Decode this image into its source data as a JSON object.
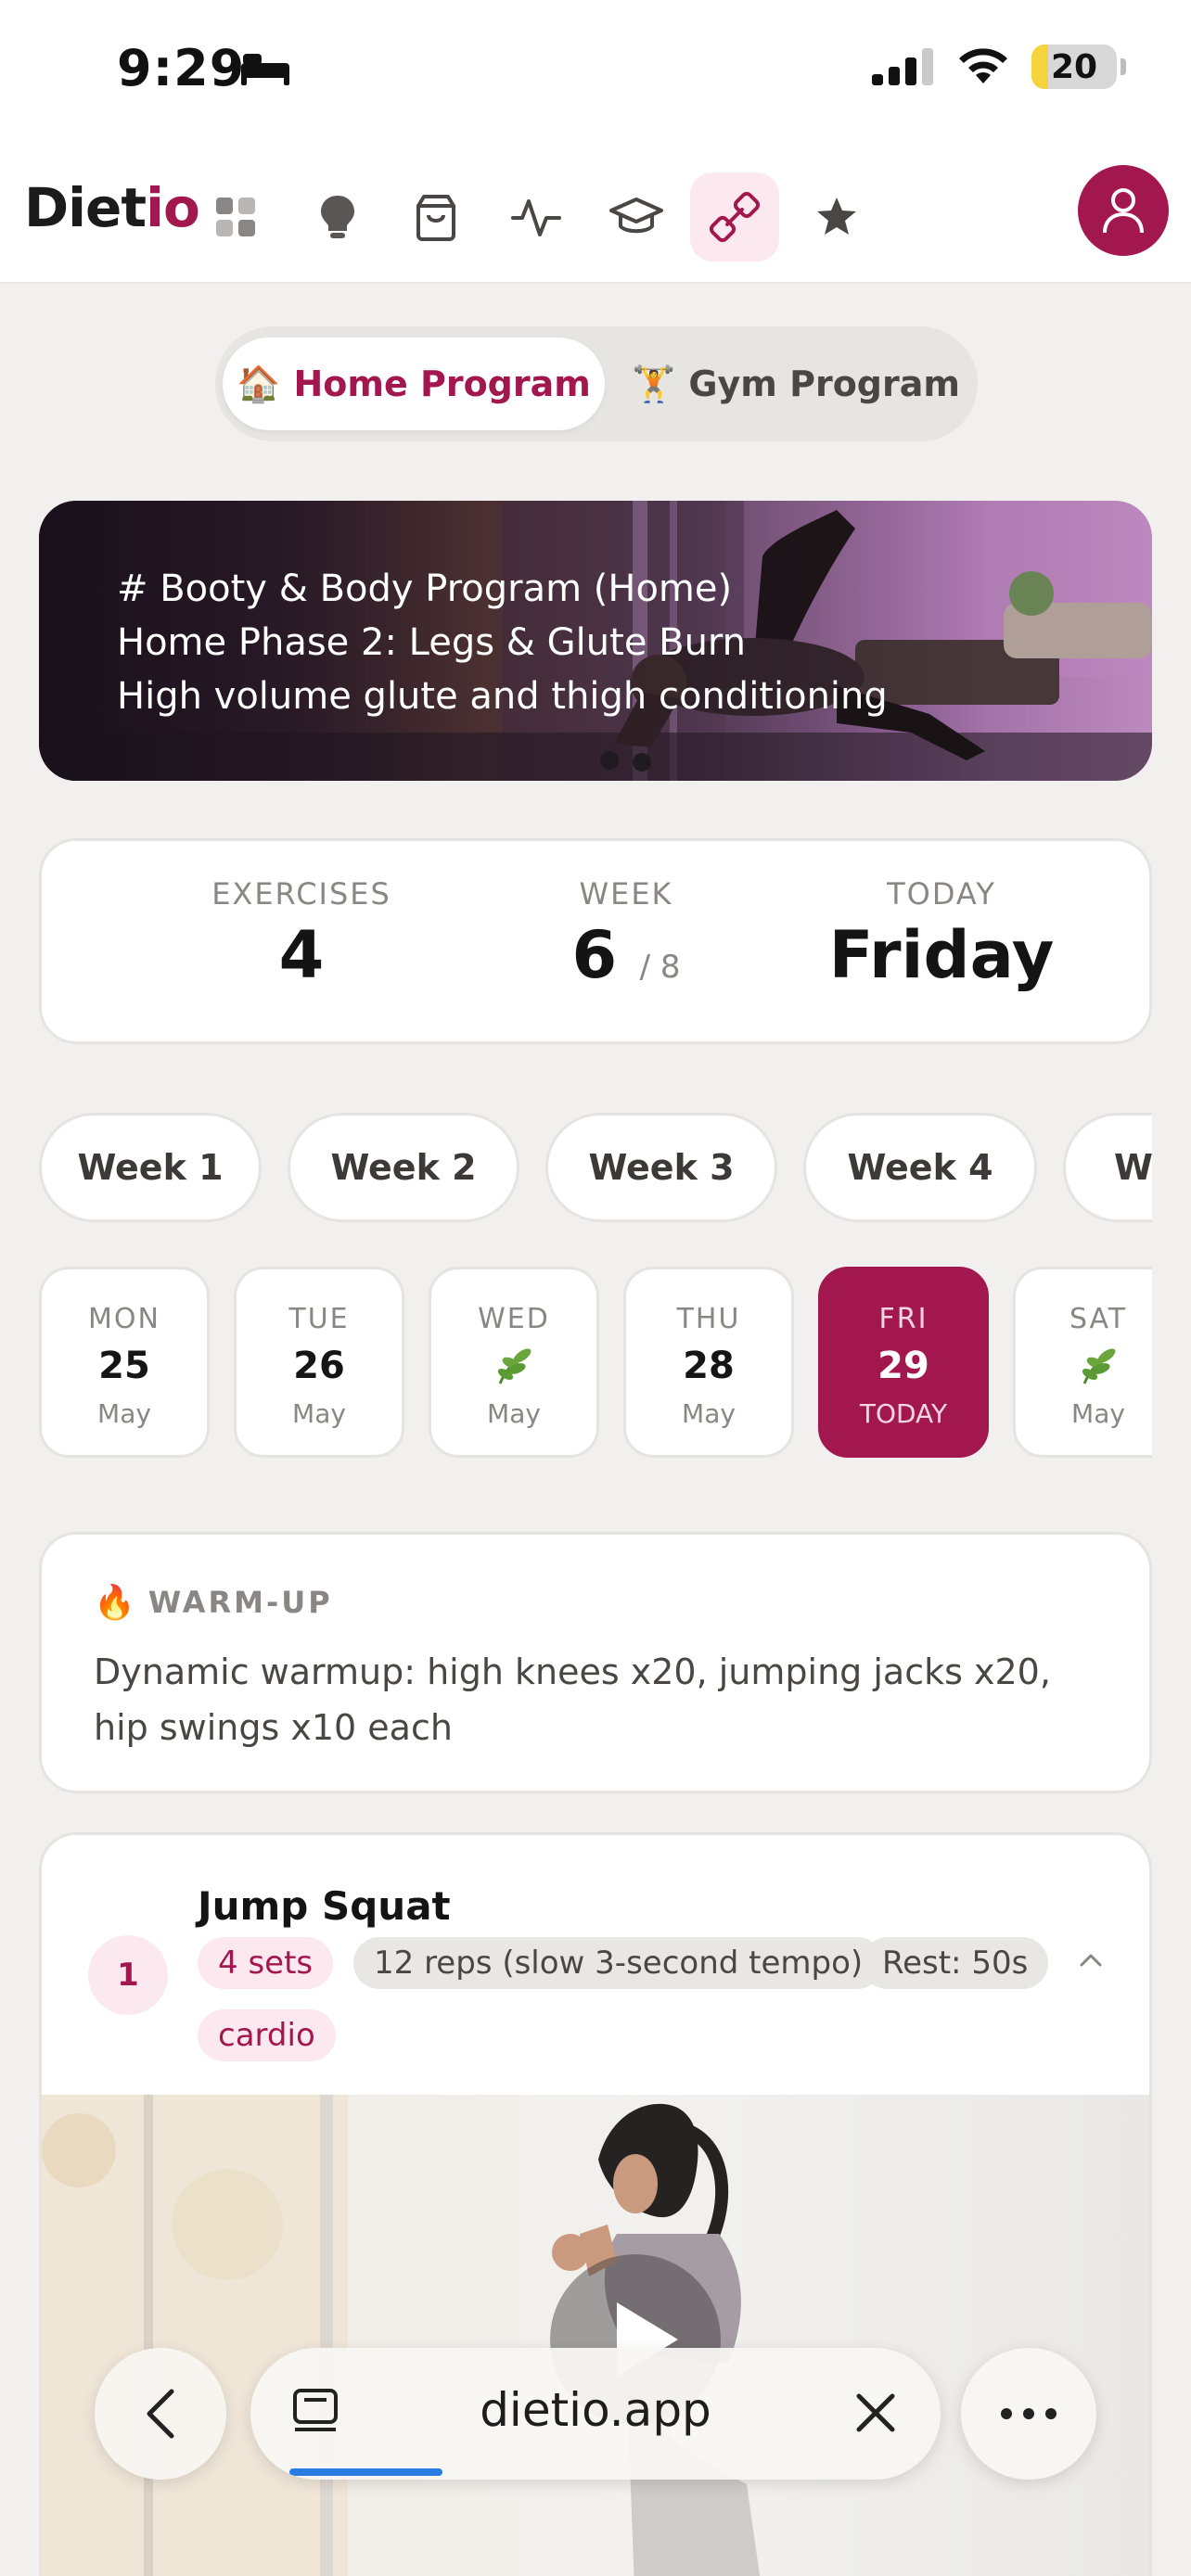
{
  "status_bar": {
    "time": "9:29",
    "battery_level": "20",
    "battery_fraction": 0.2
  },
  "nav": {
    "logo_main": "Diet",
    "logo_accent": "io",
    "icons": [
      "dashboard-icon",
      "lightbulb-icon",
      "shopping-bag-icon",
      "activity-icon",
      "graduation-cap-icon",
      "dumbbell-icon",
      "star-icon"
    ],
    "active_icon": "dumbbell-icon"
  },
  "program_toggle": {
    "home_emoji": "🏠",
    "home_label": "Home Program",
    "gym_emoji": "🏋️",
    "gym_label": "Gym Program",
    "active": "home"
  },
  "hero": {
    "line1": "# Booty & Body Program (Home)",
    "line2": "Home Phase 2: Legs & Glute Burn",
    "line3": "High volume glute and thigh conditioning"
  },
  "stats": {
    "exercises_label": "EXERCISES",
    "exercises_value": "4",
    "week_label": "WEEK",
    "week_value": "6",
    "week_total": "/ 8",
    "today_label": "TODAY",
    "today_value": "Friday"
  },
  "weeks": [
    {
      "label": "Week 1"
    },
    {
      "label": "Week 2"
    },
    {
      "label": "Week 3"
    },
    {
      "label": "Week 4"
    },
    {
      "label": "We"
    }
  ],
  "days": [
    {
      "name": "MON",
      "num": "25",
      "month": "May",
      "rest": false,
      "active": false
    },
    {
      "name": "TUE",
      "num": "26",
      "month": "May",
      "rest": false,
      "active": false
    },
    {
      "name": "WED",
      "num": "",
      "month": "May",
      "rest": true,
      "active": false
    },
    {
      "name": "THU",
      "num": "28",
      "month": "May",
      "rest": false,
      "active": false
    },
    {
      "name": "FRI",
      "num": "29",
      "month": "TODAY",
      "rest": false,
      "active": true
    },
    {
      "name": "SAT",
      "num": "",
      "month": "May",
      "rest": true,
      "active": false
    }
  ],
  "warmup": {
    "emoji": "🔥",
    "title": "WARM-UP",
    "text": "Dynamic warmup: high knees x20, jumping jacks x20, hip swings x10 each"
  },
  "exercise": {
    "number": "1",
    "name": "Jump Squat",
    "sets": "4 sets",
    "reps": "12 reps (slow 3-second tempo)",
    "rest": "Rest: 50s",
    "category": "cardio"
  },
  "browser": {
    "url": "dietio.app",
    "load_progress": 0.25
  },
  "colors": {
    "accent": "#A3174F",
    "accent_light": "#FCE9EF",
    "background": "#F1F0EE",
    "progress_blue": "#2A7BE4"
  }
}
